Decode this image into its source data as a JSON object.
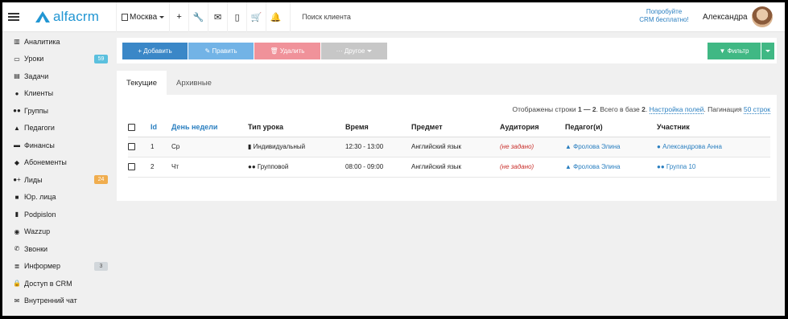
{
  "header": {
    "logo_text": "alfacrm",
    "branch": "Москва",
    "search_placeholder": "Поиск клиента",
    "promo_line1": "Попробуйте",
    "promo_line2": "CRM бесплатно!",
    "user_name": "Александра"
  },
  "sidebar": {
    "items": [
      {
        "label": "Аналитика",
        "icon": "chart-icon",
        "glyph": "▥"
      },
      {
        "label": "Уроки",
        "icon": "calendar-icon",
        "glyph": "▭",
        "badge": "59",
        "badge_color": "teal"
      },
      {
        "label": "Задачи",
        "icon": "clipboard-icon",
        "glyph": "▤"
      },
      {
        "label": "Клиенты",
        "icon": "user-icon",
        "glyph": "●"
      },
      {
        "label": "Группы",
        "icon": "users-icon",
        "glyph": "●●"
      },
      {
        "label": "Педагоги",
        "icon": "graduation-cap-icon",
        "glyph": "▲"
      },
      {
        "label": "Финансы",
        "icon": "money-icon",
        "glyph": "▬"
      },
      {
        "label": "Абонементы",
        "icon": "tag-icon",
        "glyph": "◆"
      },
      {
        "label": "Лиды",
        "icon": "user-plus-icon",
        "glyph": "●+",
        "badge": "24",
        "badge_color": "orange"
      },
      {
        "label": "Юр. лица",
        "icon": "briefcase-icon",
        "glyph": "■"
      },
      {
        "label": "Podpislon",
        "icon": "file-icon",
        "glyph": "▮"
      },
      {
        "label": "Wazzup",
        "icon": "whatsapp-icon",
        "glyph": "◉"
      },
      {
        "label": "Звонки",
        "icon": "phone-icon",
        "glyph": "✆"
      },
      {
        "label": "Информер",
        "icon": "list-icon",
        "glyph": "≣",
        "badge": "3",
        "badge_color": "grey"
      },
      {
        "label": "Доступ в CRM",
        "icon": "lock-icon",
        "glyph": "🔒"
      },
      {
        "label": "Внутренний чат",
        "icon": "envelope-icon",
        "glyph": "✉"
      }
    ]
  },
  "toolbar": {
    "add_label": "+ Добавить",
    "edit_label": "✎ Править",
    "delete_label": "🗑 Удалить",
    "other_label": "··· Другое",
    "filter_label": "▼ Фильтр"
  },
  "tabs": {
    "current": "Текущие",
    "archive": "Архивные"
  },
  "info": {
    "shown_text": "Отображены строки",
    "range": "1 — 2",
    "total_text": ". Всего в базе",
    "total": "2",
    "total_end": ".",
    "settings_link": "Настройка полей",
    "pagination_label": "Пагинация",
    "pagination_link": "50 строк"
  },
  "table": {
    "headers": {
      "id": "Id",
      "weekday": "День недели",
      "lesson_type": "Тип урока",
      "time": "Время",
      "subject": "Предмет",
      "room": "Аудитория",
      "teacher": "Педагог(и)",
      "participant": "Участник"
    },
    "rows": [
      {
        "id": "1",
        "weekday": "Ср",
        "lesson_type": "Индивидуальный",
        "time": "12:30 - 13:00",
        "subject": "Английский язык",
        "room": "(не задано)",
        "teacher": "Фролова Элина",
        "participant": "Александрова Анна"
      },
      {
        "id": "2",
        "weekday": "Чт",
        "lesson_type": "Групповой",
        "time": "08:00 - 09:00",
        "subject": "Английский язык",
        "room": "(не задано)",
        "teacher": "Фролова Элина",
        "participant": "Группа 10"
      }
    ]
  }
}
